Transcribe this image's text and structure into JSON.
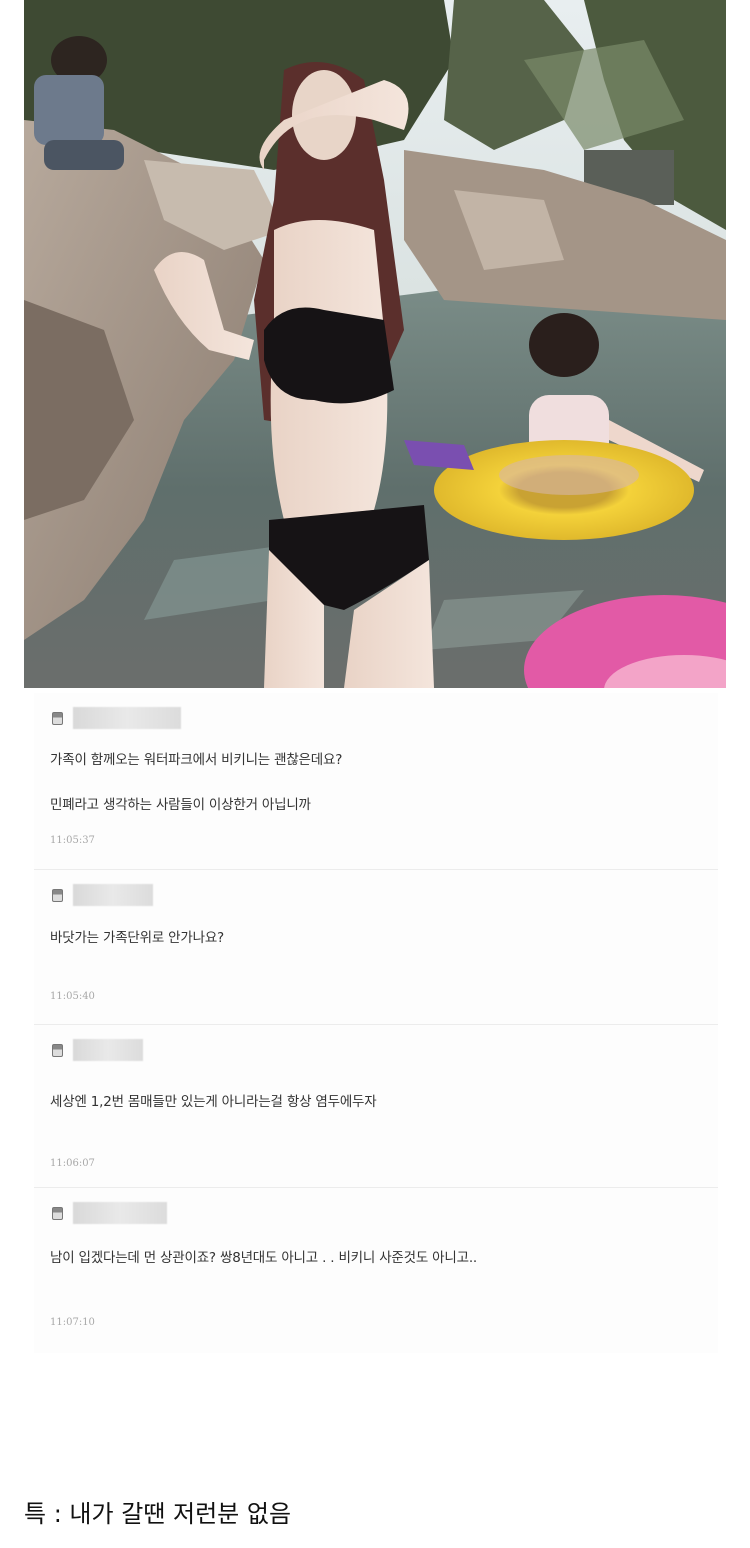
{
  "comments": [
    {
      "lines": [
        "가족이 함께오는 워터파크에서 비키니는 괜찮은데요?",
        "민폐라고 생각하는 사람들이 이상한거 아닙니까"
      ],
      "time": "11:05:37"
    },
    {
      "lines": [
        "바닷가는 가족단위로 안가나요?"
      ],
      "time": "11:05:40"
    },
    {
      "lines": [
        "세상엔 1,2번 몸매들만 있는게 아니라는걸 항상 염두에두자"
      ],
      "time": "11:06:07"
    },
    {
      "lines": [
        "남이 입겠다는데 먼 상관이죠? 쌍8년대도 아니고 . . 비키니 사준것도 아니고.."
      ],
      "time": "11:07:10"
    }
  ],
  "footer": {
    "note": "특 : 내가 갈땐 저런분 없음"
  },
  "colors": {
    "text": "#333333",
    "time": "#a8a8a8",
    "divider": "#ececec"
  }
}
